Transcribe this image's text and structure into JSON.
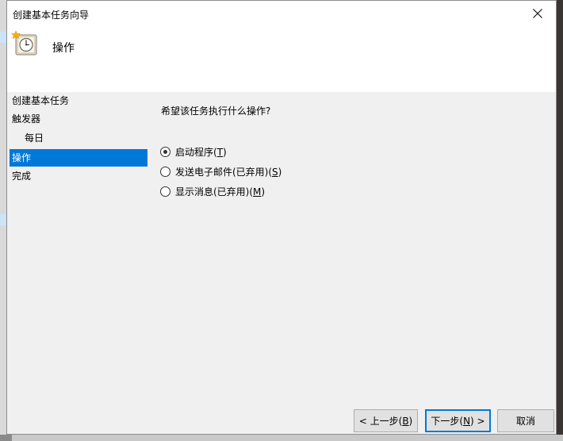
{
  "window": {
    "title": "创建基本任务向导",
    "close_glyph": "✕"
  },
  "header": {
    "title": "操作",
    "icon": "task-scheduler-clock-icon"
  },
  "nav": {
    "items": [
      {
        "label": "创建基本任务",
        "level": 0,
        "active": false
      },
      {
        "label": "触发器",
        "level": 0,
        "active": false
      },
      {
        "label": "每日",
        "level": 1,
        "active": false
      },
      {
        "label": "操作",
        "level": 0,
        "active": true
      },
      {
        "label": "完成",
        "level": 0,
        "active": false
      }
    ]
  },
  "content": {
    "question": "希望该任务执行什么操作?",
    "options": [
      {
        "prefix": "启动程序(",
        "key": "T",
        "suffix": ")",
        "checked": true
      },
      {
        "prefix": "发送电子邮件(已弃用)(",
        "key": "S",
        "suffix": ")",
        "checked": false
      },
      {
        "prefix": "显示消息(已弃用)(",
        "key": "M",
        "suffix": ")",
        "checked": false
      }
    ]
  },
  "buttons": {
    "back": {
      "prefix": "< 上一步(",
      "key": "B",
      "suffix": ")"
    },
    "next": {
      "prefix": "下一步(",
      "key": "N",
      "suffix": ") >"
    },
    "cancel": {
      "label": "取消"
    }
  },
  "colors": {
    "accent": "#0078d7",
    "window_bg": "#f0f0f0",
    "header_bg": "#ffffff"
  }
}
